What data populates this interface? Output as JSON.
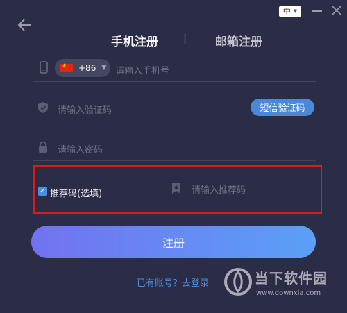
{
  "header": {
    "language": "中",
    "icons": {
      "back": "arrow-left-icon",
      "minimize": "minimize-icon",
      "close": "close-icon",
      "language_caret": "caret-down-icon"
    }
  },
  "tabs": [
    {
      "label": "手机注册",
      "active": true
    },
    {
      "label": "|"
    },
    {
      "label": "邮箱注册",
      "active": false
    }
  ],
  "form": {
    "phone": {
      "country_code": "+86",
      "placeholder": "请输入手机号",
      "icon": "phone-icon",
      "flag": "china-flag-icon"
    },
    "code": {
      "placeholder": "请输入验证码",
      "icon": "shield-check-icon",
      "button_label": "短信验证码"
    },
    "password": {
      "placeholder": "请输入密码",
      "icon": "lock-icon"
    },
    "referral": {
      "checkbox_label": "推荐码(选填)",
      "checked": true,
      "placeholder": "请输入推荐码",
      "icon": "bookmark-star-icon"
    },
    "submit_label": "注册",
    "login_link": "已有账号？去登录"
  },
  "watermark": {
    "title": "当下软件园",
    "url": "www.downxia.com"
  },
  "colors": {
    "background": "#2b2c46",
    "accent": "#4a88d8",
    "gradient_start": "#7272f0",
    "gradient_end": "#5aa0f7",
    "highlight": "#e01919"
  }
}
